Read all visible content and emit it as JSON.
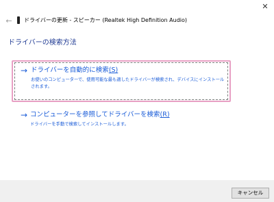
{
  "window": {
    "title": "ドライバーの更新 - スピーカー (Realtek High Definition Audio)",
    "back_glyph": "←",
    "close_glyph": "✕"
  },
  "heading": "ドライバーの検索方法",
  "options": [
    {
      "title": "ドライバーを自動的に検索",
      "hotkey": "(S)",
      "description": "お使いのコンピューターで、使用可能な最も適したドライバーが検索され、デバイスにインストールされます。"
    },
    {
      "title": "コンピューターを参照してドライバーを検索",
      "hotkey": "(R)",
      "description": "ドライバーを手動で検索してインストールします。"
    }
  ],
  "arrow_glyph": "→",
  "footer": {
    "cancel_label": "キャンセル"
  }
}
